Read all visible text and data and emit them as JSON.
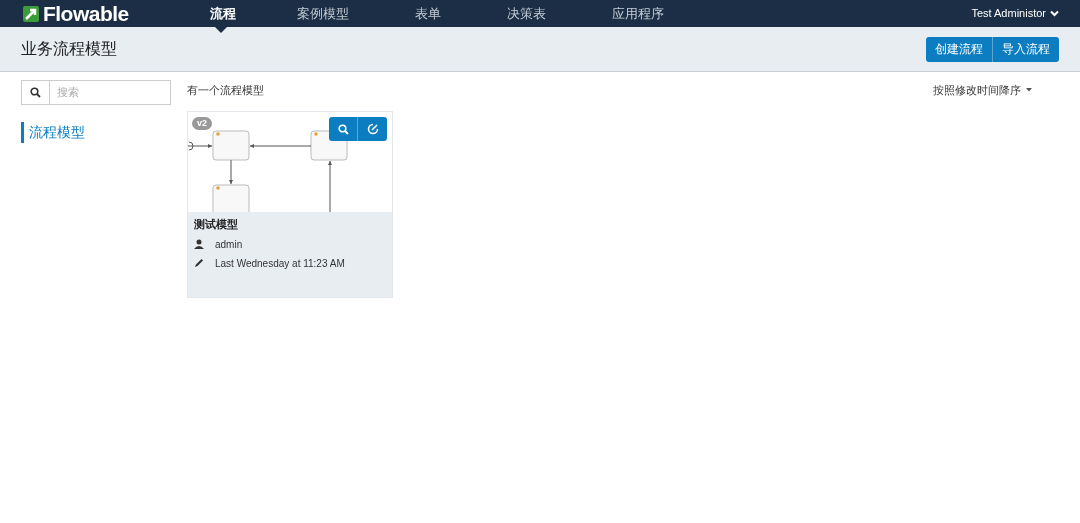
{
  "nav": {
    "logo": "Flowable",
    "tabs": [
      {
        "label": "流程",
        "selected": true
      },
      {
        "label": "案例模型",
        "selected": false
      },
      {
        "label": "表单",
        "selected": false
      },
      {
        "label": "决策表",
        "selected": false
      },
      {
        "label": "应用程序",
        "selected": false
      }
    ],
    "user": "Test Administor"
  },
  "header": {
    "title": "业务流程模型",
    "buttons": [
      "创建流程",
      "导入流程"
    ]
  },
  "search": {
    "placeholder": "搜索"
  },
  "sidebar": {
    "items": [
      {
        "label": "流程模型",
        "selected": true
      }
    ]
  },
  "summary": "有一个流程模型",
  "sort": "按照修改时间降序",
  "models": [
    {
      "version": "v2",
      "name": "测试模型",
      "owner": "admin",
      "modified": "Last Wednesday at 11:23 AM"
    }
  ]
}
